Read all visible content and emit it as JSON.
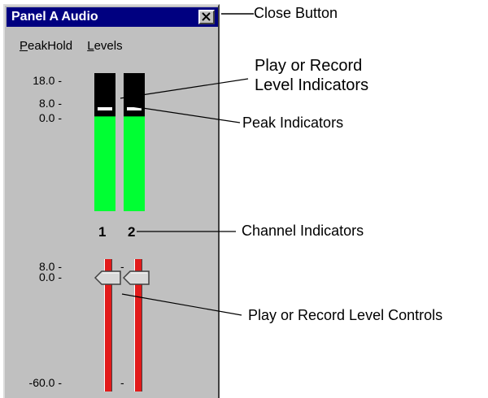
{
  "window": {
    "title": "Panel A Audio",
    "close_icon": "close-x-icon"
  },
  "menu": {
    "items": [
      {
        "label": "PeakHold",
        "mnemonic": "P"
      },
      {
        "label": "Levels",
        "mnemonic": "L"
      }
    ]
  },
  "meters": {
    "scale_labels": [
      "18.0 -",
      "8.0 -",
      "0.0 -"
    ],
    "channels": [
      {
        "label": "1",
        "level_fraction": 0.68,
        "peak_db": 8.0
      },
      {
        "label": "2",
        "level_fraction": 0.68,
        "peak_db": 8.0
      }
    ]
  },
  "controls": {
    "scale_labels": [
      "8.0 -",
      "0.0 -",
      "-60.0 -"
    ],
    "channels": [
      {
        "label": "1",
        "setting_db": 0.0
      },
      {
        "label": "2",
        "setting_db": 0.0
      }
    ]
  },
  "callouts": {
    "close_button": "Close Button",
    "level_indicators_line1": "Play or Record",
    "level_indicators_line2": "Level Indicators",
    "peak_indicators": "Peak Indicators",
    "channel_indicators": "Channel Indicators",
    "level_controls": "Play or Record Level Controls"
  },
  "colors": {
    "title_bar": "#000080",
    "meter_level": "#00ff33",
    "meter_background": "#000000",
    "slider_track": "#e21a1a",
    "panel": "#c0c0c0"
  }
}
